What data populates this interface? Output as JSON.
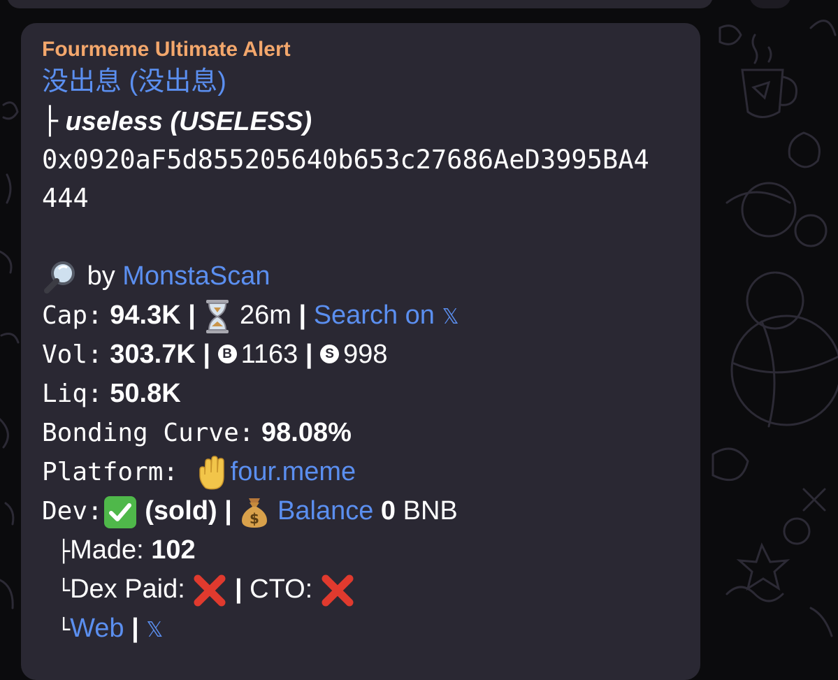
{
  "message": {
    "sender": "Fourmeme Ultimate Alert",
    "title_link": "没出息 (没出息)",
    "token_prefix": "├",
    "token_name": "useless (USELESS)",
    "address_line1": "0x0920aF5d855205640b653c27686AeD3995BA4",
    "address_line2": "444",
    "scan": {
      "icon": "magnifier-icon",
      "by_text": "by",
      "link": "MonstaScan"
    },
    "cap": {
      "label": "Cap:",
      "value": "94.3K",
      "sep": "|",
      "icon": "hourglass-icon",
      "age": "26m",
      "search_link": "Search on",
      "x_glyph": "𝕏"
    },
    "vol": {
      "label": "Vol:",
      "value": "303.7K",
      "sep": "|",
      "buy_glyph": "B",
      "buys": "1163",
      "sell_glyph": "S",
      "sells": "998"
    },
    "liq": {
      "label": "Liq:",
      "value": "50.8K"
    },
    "bonding": {
      "label": "Bonding Curve:",
      "value": "98.08%"
    },
    "platform": {
      "label": "Platform:",
      "icon": "raised-hand-icon",
      "link": "four.meme"
    },
    "dev": {
      "label": "Dev:",
      "check_icon": "check-mark-icon",
      "status": "(sold)",
      "sep": "|",
      "money_icon": "money-bag-icon",
      "balance_link": "Balance",
      "balance_value": "0",
      "balance_unit": "BNB"
    },
    "made": {
      "prefix": "├",
      "label": "Made:",
      "value": "102"
    },
    "dexpaid": {
      "prefix": "└",
      "label": "Dex Paid:",
      "sep": "|",
      "cto_label": "CTO:",
      "cross_icon": "cross-mark-icon"
    },
    "links": {
      "prefix": "└",
      "web": "Web",
      "sep": "|",
      "x_glyph": "𝕏"
    }
  },
  "colors": {
    "background": "#0b0b0d",
    "bubble": "#2a2833",
    "sender": "#f3a76c",
    "link": "#5b8ff0",
    "text": "#ffffff"
  }
}
